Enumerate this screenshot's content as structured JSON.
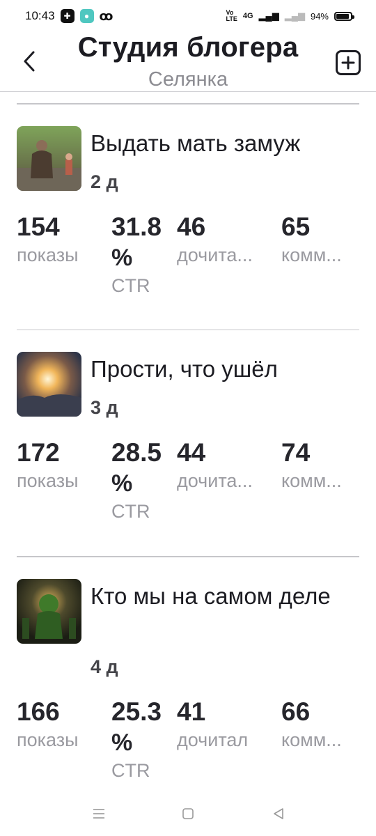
{
  "status": {
    "time": "10:43",
    "battery": "94%",
    "network": "4G"
  },
  "header": {
    "title": "Студия блогера",
    "subtitle": "Селянка"
  },
  "posts": [
    {
      "title": "Выдать мать замуж",
      "age": "2 д",
      "stats": {
        "views": "154",
        "views_label": "показы",
        "ctr_a": "31.8",
        "ctr_b": "%",
        "ctr_label": "CTR",
        "read": "46",
        "read_label": "дочита...",
        "comments": "65",
        "comments_label": "комм..."
      }
    },
    {
      "title": "Прости, что ушёл",
      "age": "3 д",
      "stats": {
        "views": "172",
        "views_label": "показы",
        "ctr_a": "28.5",
        "ctr_b": "%",
        "ctr_label": "CTR",
        "read": "44",
        "read_label": "дочита...",
        "comments": "74",
        "comments_label": "комм..."
      }
    },
    {
      "title": "Кто мы на самом деле",
      "age": "4 д",
      "stats": {
        "views": "166",
        "views_label": "показы",
        "ctr_a": "25.3",
        "ctr_b": "%",
        "ctr_label": "CTR",
        "read": "41",
        "read_label": "дочитал",
        "comments": "66",
        "comments_label": "комм..."
      }
    }
  ],
  "icons": {
    "back": "chevron-left-icon",
    "add": "plus-square-icon",
    "nav_menu": "menu-icon",
    "nav_home": "square-icon",
    "nav_back": "triangle-back-icon"
  },
  "colors": {
    "text": "#1c1c22",
    "muted": "#9a9aa0",
    "divider": "#c6c6ca"
  }
}
